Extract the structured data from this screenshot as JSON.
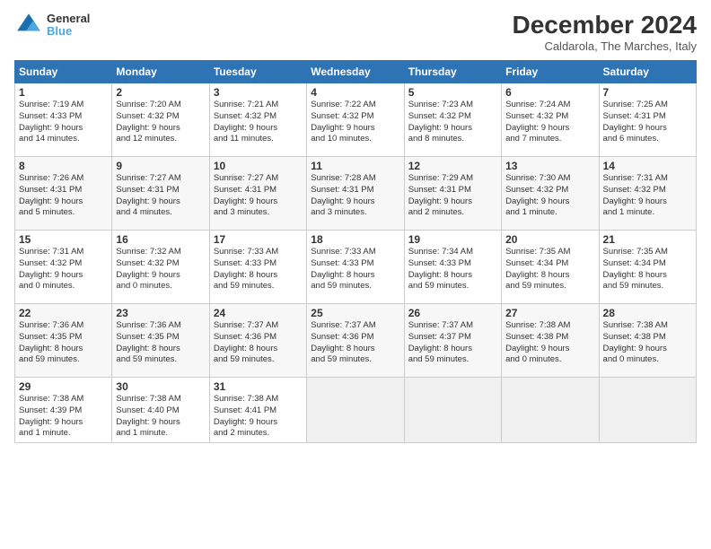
{
  "header": {
    "logo_line1": "General",
    "logo_line2": "Blue",
    "title": "December 2024",
    "subtitle": "Caldarola, The Marches, Italy"
  },
  "weekdays": [
    "Sunday",
    "Monday",
    "Tuesday",
    "Wednesday",
    "Thursday",
    "Friday",
    "Saturday"
  ],
  "weeks": [
    [
      {
        "day": "1",
        "info": "Sunrise: 7:19 AM\nSunset: 4:33 PM\nDaylight: 9 hours\nand 14 minutes."
      },
      {
        "day": "2",
        "info": "Sunrise: 7:20 AM\nSunset: 4:32 PM\nDaylight: 9 hours\nand 12 minutes."
      },
      {
        "day": "3",
        "info": "Sunrise: 7:21 AM\nSunset: 4:32 PM\nDaylight: 9 hours\nand 11 minutes."
      },
      {
        "day": "4",
        "info": "Sunrise: 7:22 AM\nSunset: 4:32 PM\nDaylight: 9 hours\nand 10 minutes."
      },
      {
        "day": "5",
        "info": "Sunrise: 7:23 AM\nSunset: 4:32 PM\nDaylight: 9 hours\nand 8 minutes."
      },
      {
        "day": "6",
        "info": "Sunrise: 7:24 AM\nSunset: 4:32 PM\nDaylight: 9 hours\nand 7 minutes."
      },
      {
        "day": "7",
        "info": "Sunrise: 7:25 AM\nSunset: 4:31 PM\nDaylight: 9 hours\nand 6 minutes."
      }
    ],
    [
      {
        "day": "8",
        "info": "Sunrise: 7:26 AM\nSunset: 4:31 PM\nDaylight: 9 hours\nand 5 minutes."
      },
      {
        "day": "9",
        "info": "Sunrise: 7:27 AM\nSunset: 4:31 PM\nDaylight: 9 hours\nand 4 minutes."
      },
      {
        "day": "10",
        "info": "Sunrise: 7:27 AM\nSunset: 4:31 PM\nDaylight: 9 hours\nand 3 minutes."
      },
      {
        "day": "11",
        "info": "Sunrise: 7:28 AM\nSunset: 4:31 PM\nDaylight: 9 hours\nand 3 minutes."
      },
      {
        "day": "12",
        "info": "Sunrise: 7:29 AM\nSunset: 4:31 PM\nDaylight: 9 hours\nand 2 minutes."
      },
      {
        "day": "13",
        "info": "Sunrise: 7:30 AM\nSunset: 4:32 PM\nDaylight: 9 hours\nand 1 minute."
      },
      {
        "day": "14",
        "info": "Sunrise: 7:31 AM\nSunset: 4:32 PM\nDaylight: 9 hours\nand 1 minute."
      }
    ],
    [
      {
        "day": "15",
        "info": "Sunrise: 7:31 AM\nSunset: 4:32 PM\nDaylight: 9 hours\nand 0 minutes."
      },
      {
        "day": "16",
        "info": "Sunrise: 7:32 AM\nSunset: 4:32 PM\nDaylight: 9 hours\nand 0 minutes."
      },
      {
        "day": "17",
        "info": "Sunrise: 7:33 AM\nSunset: 4:33 PM\nDaylight: 8 hours\nand 59 minutes."
      },
      {
        "day": "18",
        "info": "Sunrise: 7:33 AM\nSunset: 4:33 PM\nDaylight: 8 hours\nand 59 minutes."
      },
      {
        "day": "19",
        "info": "Sunrise: 7:34 AM\nSunset: 4:33 PM\nDaylight: 8 hours\nand 59 minutes."
      },
      {
        "day": "20",
        "info": "Sunrise: 7:35 AM\nSunset: 4:34 PM\nDaylight: 8 hours\nand 59 minutes."
      },
      {
        "day": "21",
        "info": "Sunrise: 7:35 AM\nSunset: 4:34 PM\nDaylight: 8 hours\nand 59 minutes."
      }
    ],
    [
      {
        "day": "22",
        "info": "Sunrise: 7:36 AM\nSunset: 4:35 PM\nDaylight: 8 hours\nand 59 minutes."
      },
      {
        "day": "23",
        "info": "Sunrise: 7:36 AM\nSunset: 4:35 PM\nDaylight: 8 hours\nand 59 minutes."
      },
      {
        "day": "24",
        "info": "Sunrise: 7:37 AM\nSunset: 4:36 PM\nDaylight: 8 hours\nand 59 minutes."
      },
      {
        "day": "25",
        "info": "Sunrise: 7:37 AM\nSunset: 4:36 PM\nDaylight: 8 hours\nand 59 minutes."
      },
      {
        "day": "26",
        "info": "Sunrise: 7:37 AM\nSunset: 4:37 PM\nDaylight: 8 hours\nand 59 minutes."
      },
      {
        "day": "27",
        "info": "Sunrise: 7:38 AM\nSunset: 4:38 PM\nDaylight: 9 hours\nand 0 minutes."
      },
      {
        "day": "28",
        "info": "Sunrise: 7:38 AM\nSunset: 4:38 PM\nDaylight: 9 hours\nand 0 minutes."
      }
    ],
    [
      {
        "day": "29",
        "info": "Sunrise: 7:38 AM\nSunset: 4:39 PM\nDaylight: 9 hours\nand 1 minute."
      },
      {
        "day": "30",
        "info": "Sunrise: 7:38 AM\nSunset: 4:40 PM\nDaylight: 9 hours\nand 1 minute."
      },
      {
        "day": "31",
        "info": "Sunrise: 7:38 AM\nSunset: 4:41 PM\nDaylight: 9 hours\nand 2 minutes."
      },
      {
        "day": "",
        "info": ""
      },
      {
        "day": "",
        "info": ""
      },
      {
        "day": "",
        "info": ""
      },
      {
        "day": "",
        "info": ""
      }
    ]
  ]
}
